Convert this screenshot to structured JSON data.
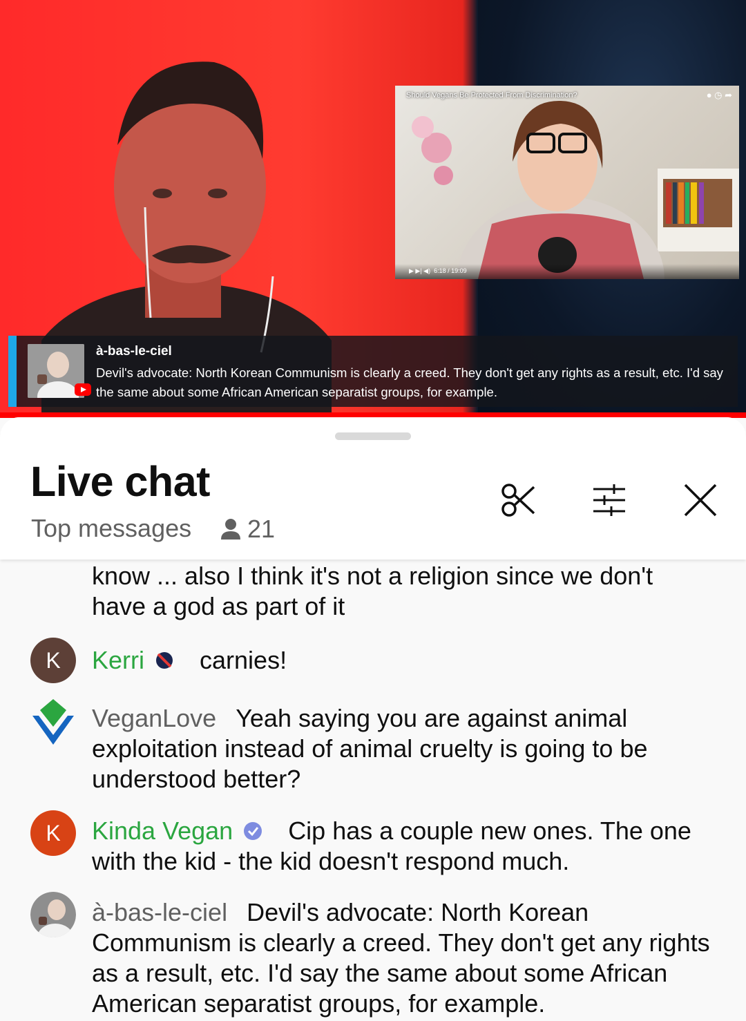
{
  "video": {
    "pip_title": "Should Vegans Be Protected From Discrimination?",
    "pip_time": "6:18 / 19:09",
    "overlay": {
      "author": "à-bas-le-ciel",
      "message": "Devil's advocate: North Korean Communism is clearly a creed. They don't get any rights as a result, etc. I'd say the same about some African American separatist groups, for example."
    }
  },
  "header": {
    "title": "Live chat",
    "mode": "Top messages",
    "viewer_count": "21",
    "icons": [
      "clip-icon",
      "filter-sliders-icon",
      "close-icon"
    ]
  },
  "messages": [
    {
      "author": "",
      "text": "know ... also I think it's not a religion since we don't have a god as part of it"
    },
    {
      "author": "Kerri",
      "avatar_letter": "K",
      "avatar_color": "#5d4037",
      "author_color": "#2ba640",
      "badge": "member-badge-icon",
      "text": "carnies!"
    },
    {
      "author": "VeganLove",
      "avatar_icon": "vegan-v-logo-icon",
      "author_color": "#606060",
      "text": "Yeah saying you are against animal exploitation instead of animal cruelty is going to be understood better?"
    },
    {
      "author": "Kinda Vegan",
      "avatar_letter": "K",
      "avatar_color": "#d84315",
      "author_color": "#2ba640",
      "badge": "member-badge-icon",
      "text": "Cip has a couple new ones. The one with the kid - the kid doesn't respond much."
    },
    {
      "author": "à-bas-le-ciel",
      "avatar_icon": "photo-avatar",
      "author_color": "#606060",
      "text": "Devil's advocate: North Korean Communism is clearly a creed. They don't get any rights as a result, etc. I'd say the same about some African American separatist groups, for example."
    }
  ]
}
